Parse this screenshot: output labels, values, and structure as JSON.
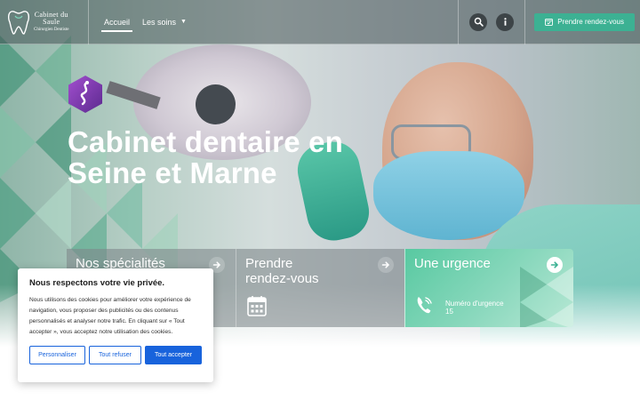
{
  "header": {
    "logo": {
      "name_line1": "Cabinet du",
      "name_line2": "Saule",
      "subtitle": "Chirurgien Dentiste"
    },
    "nav": [
      {
        "label": "Accueil",
        "active": true
      },
      {
        "label": "Les soins",
        "active": false,
        "dropdown": true
      }
    ],
    "icons": [
      "search-icon",
      "info-icon"
    ],
    "cta_label": "Prendre rendez-vous"
  },
  "hero": {
    "title_line1": "Cabinet dentaire en",
    "title_line2": "Seine et Marne"
  },
  "cards": [
    {
      "title": "Nos spécialités"
    },
    {
      "title_line1": "Prendre",
      "title_line2": "rendez-vous"
    },
    {
      "title": "Une urgence",
      "label": "Numéro d'urgence",
      "number": "15"
    }
  ],
  "cookie": {
    "title": "Nous respectons votre vie privée.",
    "text": "Nous utilisons des cookies pour améliorer votre expérience de navigation, vous proposer des publicités ou des contenus personnalisés et analyser notre trafic. En cliquant sur « Tout accepter », vous acceptez notre utilisation des cookies.",
    "btn_customize": "Personnaliser",
    "btn_refuse": "Tout refuser",
    "btn_accept": "Tout accepter"
  },
  "colors": {
    "accent": "#3cb193",
    "cookie_blue": "#1863dc",
    "badge_purple": "#8a3fb3"
  }
}
